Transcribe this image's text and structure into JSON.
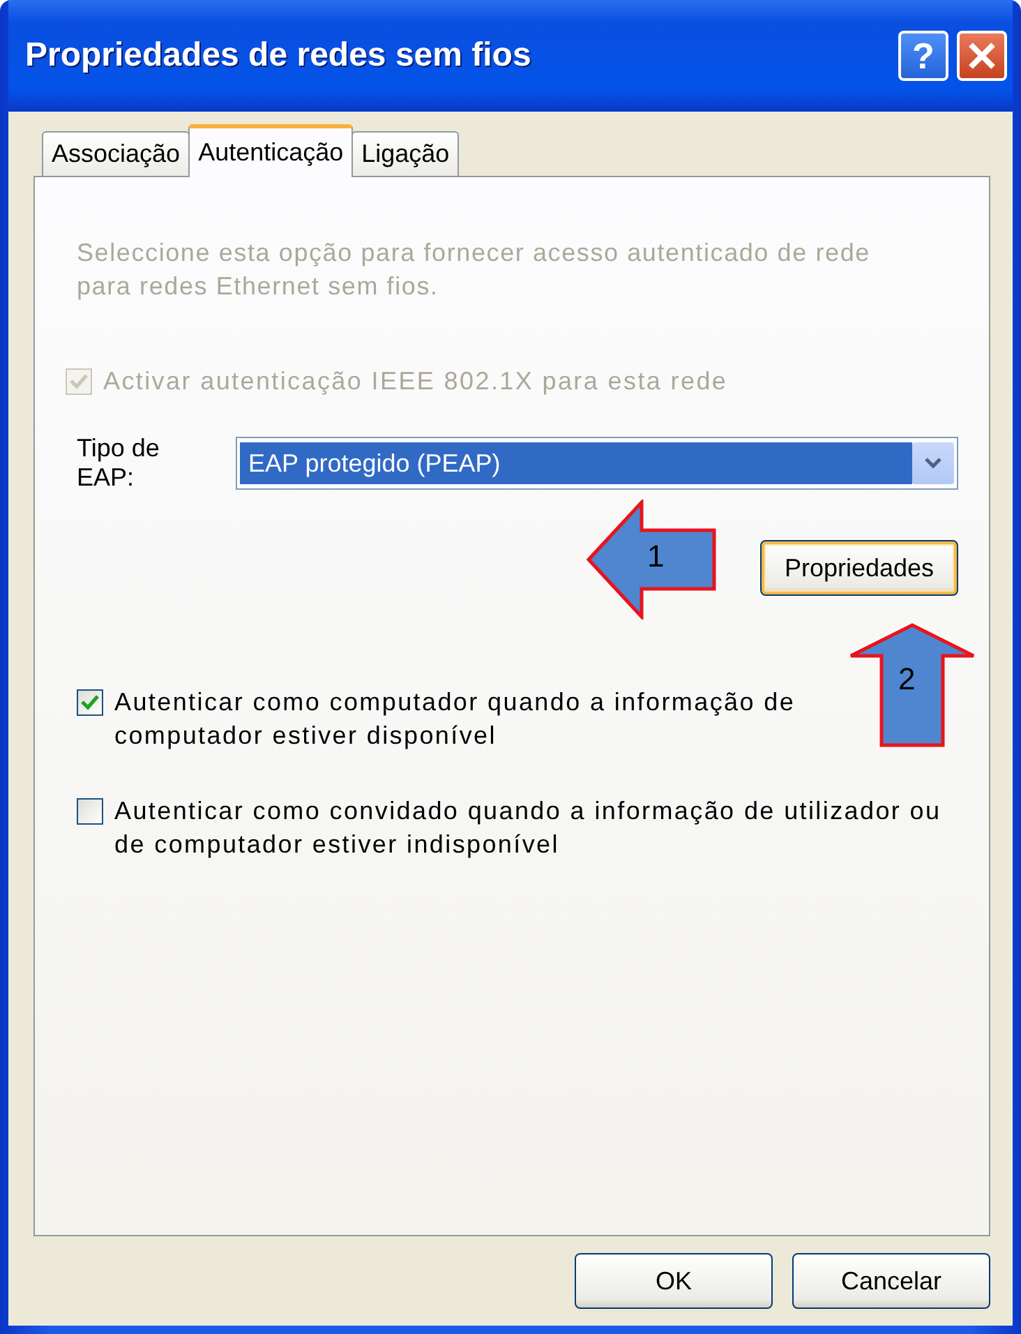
{
  "window": {
    "title": "Propriedades de redes sem fios",
    "help_button": "?"
  },
  "tabs": [
    {
      "label": "Associação",
      "selected": false
    },
    {
      "label": "Autenticação",
      "selected": true
    },
    {
      "label": "Ligação",
      "selected": false
    }
  ],
  "description": {
    "text": "Seleccione esta opção para fornecer acesso autenticado de rede para redes Ethernet sem fios.",
    "disabled": true
  },
  "enable_8021x": {
    "label": "Activar autenticação IEEE 802.1X para esta rede",
    "checked": true,
    "disabled": true
  },
  "eap_type": {
    "label": "Tipo de EAP:",
    "value": "EAP protegido (PEAP)",
    "selected": true
  },
  "properties_button": "Propriedades",
  "checkboxes": [
    {
      "label": "Autenticar como computador quando a informação de computador estiver disponível",
      "checked": true,
      "disabled": false
    },
    {
      "label": "Autenticar como convidado quando a informação de utilizador ou de computador estiver indisponível",
      "checked": false,
      "disabled": false
    }
  ],
  "annotations": [
    {
      "label": "1",
      "kind": "left"
    },
    {
      "label": "2",
      "kind": "up"
    }
  ],
  "buttons": [
    "OK",
    "Cancelar"
  ]
}
